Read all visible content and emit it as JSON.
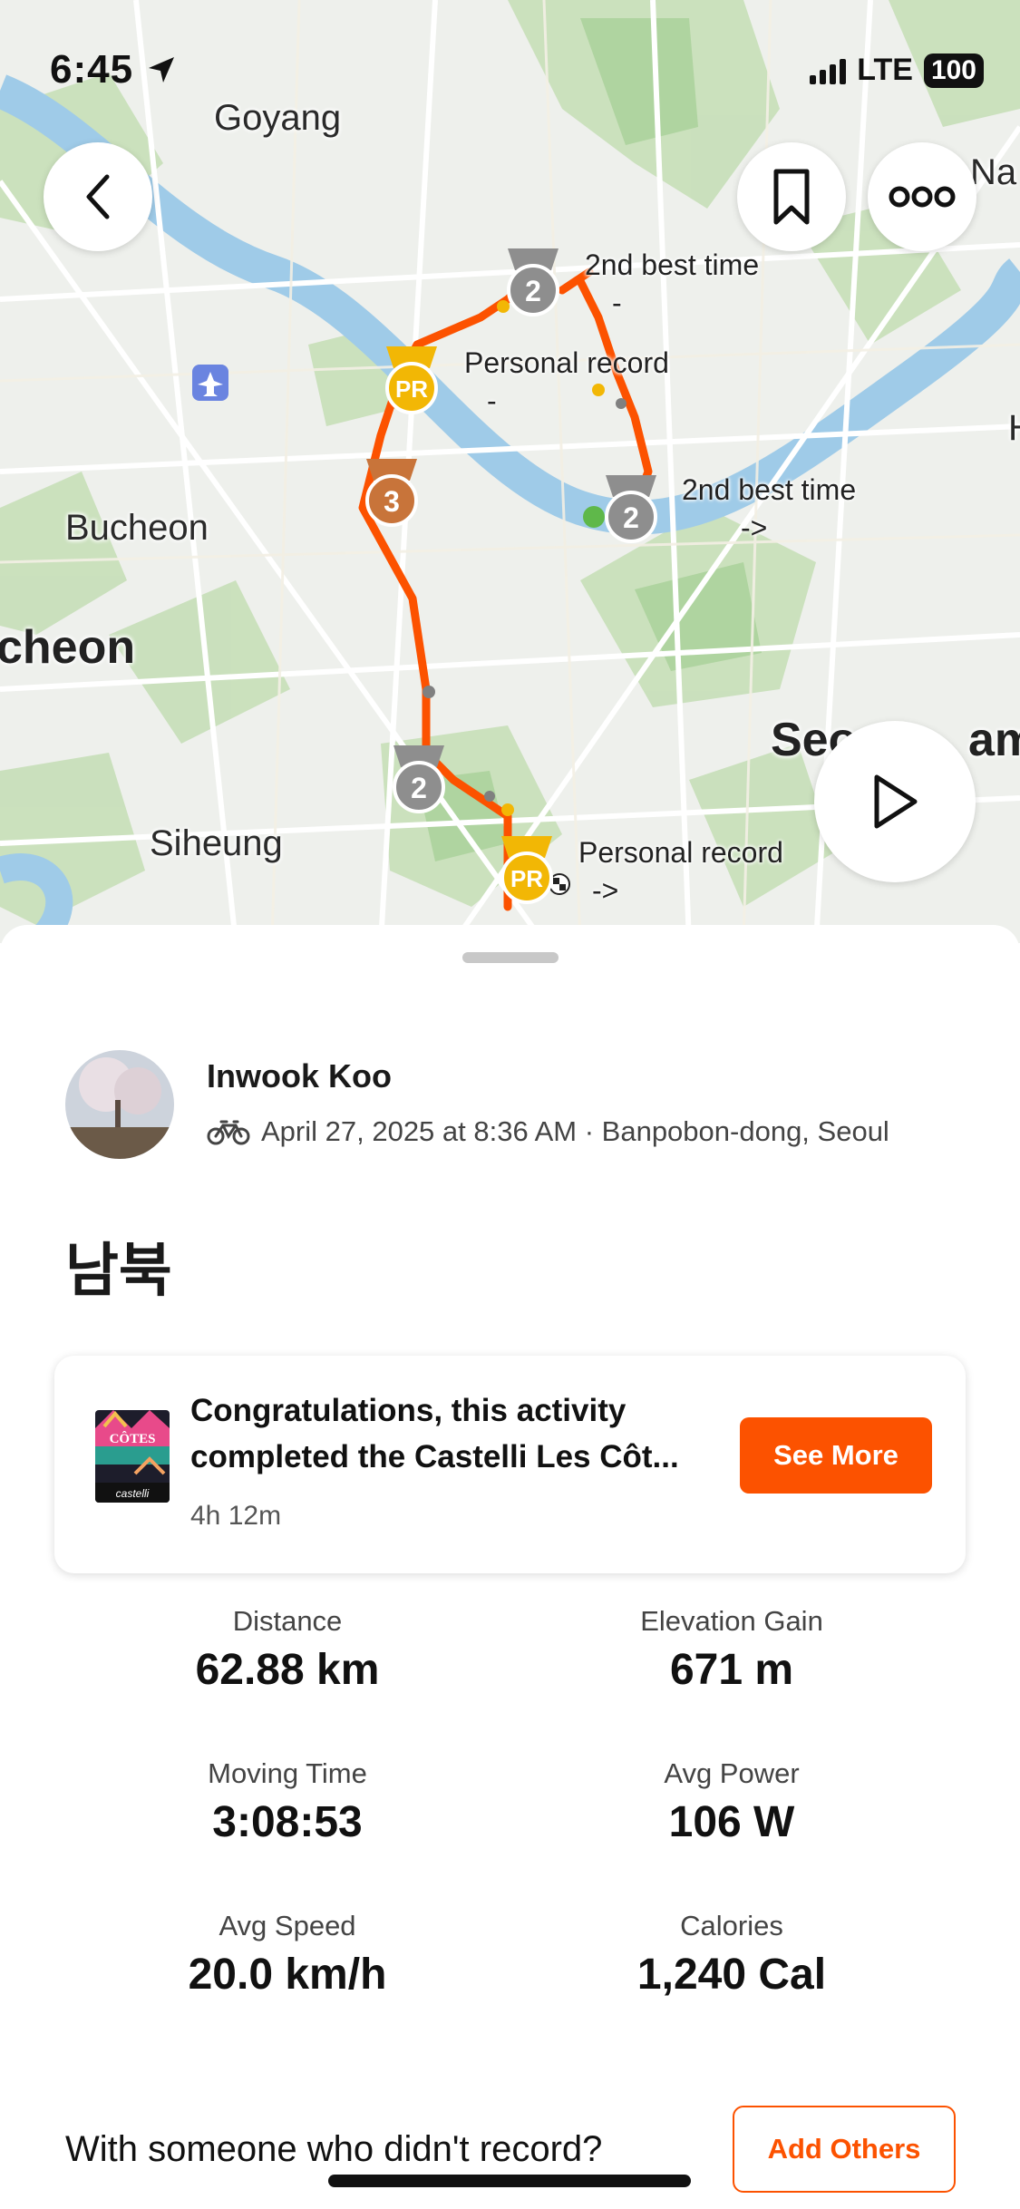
{
  "status_bar": {
    "time": "6:45",
    "network": "LTE",
    "battery": "100"
  },
  "map": {
    "places": [
      "Goyang",
      "Bucheon",
      "cheon",
      "Siheung",
      "Seo",
      "am",
      "Na",
      "H"
    ],
    "annotations": [
      {
        "title": "2nd best time",
        "detail": "-"
      },
      {
        "title": "Personal record",
        "detail": "-"
      },
      {
        "title": "2nd best time",
        "detail": "->"
      },
      {
        "title": "Personal record",
        "detail": "->"
      }
    ],
    "medals": [
      {
        "label": "2",
        "kind": "silver"
      },
      {
        "label": "PR",
        "kind": "gold"
      },
      {
        "label": "3",
        "kind": "bronze"
      },
      {
        "label": "2",
        "kind": "silver"
      },
      {
        "label": "2",
        "kind": "silver"
      },
      {
        "label": "PR",
        "kind": "gold"
      }
    ],
    "route_color": "#fc5200"
  },
  "athlete": {
    "name": "Inwook Koo",
    "meta": "April 27, 2025 at 8:36 AM · Banpobon-dong, Seoul"
  },
  "activity": {
    "title": "남북"
  },
  "challenge": {
    "text": "Congratulations, this activity completed the Castelli Les Côt...",
    "duration": "4h 12m",
    "badge_title": "CÔTES",
    "badge_brand": "castelli",
    "button": "See More"
  },
  "stats": [
    {
      "label": "Distance",
      "value": "62.88 km"
    },
    {
      "label": "Elevation Gain",
      "value": "671 m"
    },
    {
      "label": "Moving Time",
      "value": "3:08:53"
    },
    {
      "label": "Avg Power",
      "value": "106 W"
    },
    {
      "label": "Avg Speed",
      "value": "20.0 km/h"
    },
    {
      "label": "Calories",
      "value": "1,240 Cal"
    }
  ],
  "together": {
    "prompt": "With someone who didn't record?",
    "button": "Add Others"
  },
  "colors": {
    "accent": "#fc5200",
    "gold": "#f2b705",
    "silver": "#8e8e8e",
    "bronze": "#c8743a"
  },
  "icons": [
    "location-arrow-icon",
    "back-chevron-icon",
    "bookmark-icon",
    "more-icon",
    "play-icon",
    "bike-icon",
    "airport-icon"
  ]
}
